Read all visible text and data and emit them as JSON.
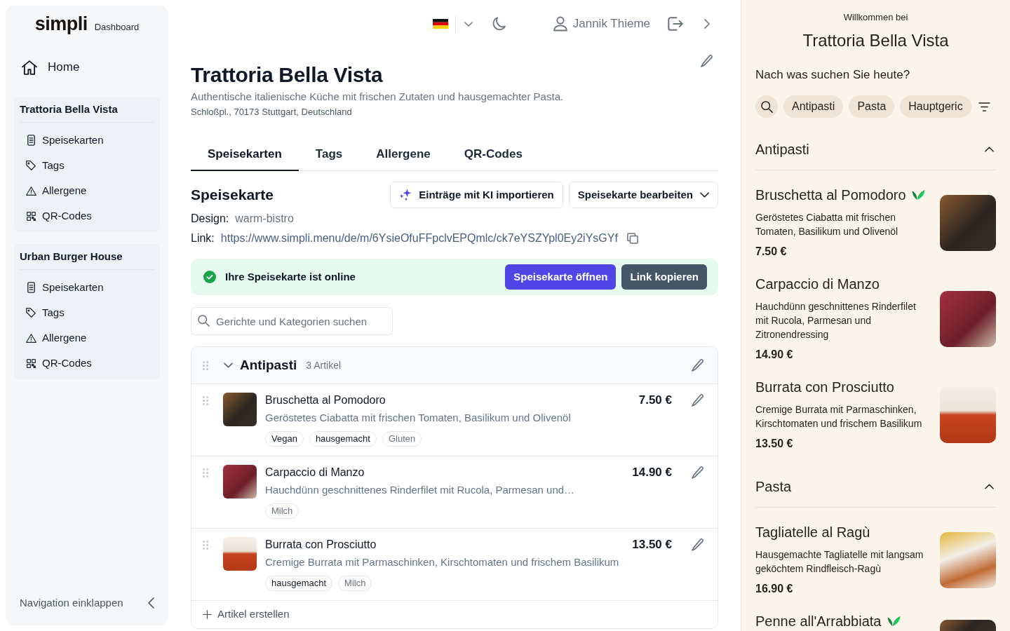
{
  "sidebar": {
    "logo": "simpli",
    "logo_caption": "Dashboard",
    "home": "Home",
    "restaurants": [
      {
        "name": "Trattoria Bella Vista",
        "items": [
          {
            "label": "Speisekarten",
            "kind": "menus"
          },
          {
            "label": "Tags",
            "kind": "tags"
          },
          {
            "label": "Allergene",
            "kind": "allergens"
          },
          {
            "label": "QR-Codes",
            "kind": "qr"
          }
        ]
      },
      {
        "name": "Urban Burger House",
        "items": [
          {
            "label": "Speisekarten",
            "kind": "menus"
          },
          {
            "label": "Tags",
            "kind": "tags"
          },
          {
            "label": "Allergene",
            "kind": "allergens"
          },
          {
            "label": "QR-Codes",
            "kind": "qr"
          }
        ]
      }
    ],
    "collapse": "Navigation einklappen"
  },
  "topbar": {
    "user": "Jannik Thieme"
  },
  "restaurant": {
    "name": "Trattoria Bella Vista",
    "description": "Authentische italienische Küche mit frischen Zutaten und hausgemachter Pasta.",
    "address": "Schloßpl., 70173 Stuttgart, Deutschland"
  },
  "tabs": [
    {
      "label": "Speisekarten",
      "selected": true
    },
    {
      "label": "Tags",
      "selected": false
    },
    {
      "label": "Allergene",
      "selected": false
    },
    {
      "label": "QR-Codes",
      "selected": false
    }
  ],
  "menu": {
    "heading": "Speisekarte",
    "actions": [
      {
        "label": "Einträge mit KI importieren",
        "kind": "ai"
      },
      {
        "label": "Speisekarte bearbeiten",
        "kind": "dropdown"
      }
    ],
    "design_label": "Design:",
    "design": "warm-bistro",
    "link_label": "Link:",
    "link": "https://www.simpli.menu/de/m/6YsieOfuFFpclvEPQmlc/ck7eYSZYpl0Ey2iYsGYf",
    "status": "Ihre Speisekarte ist online",
    "status_actions": [
      {
        "label": "Speisekarte öffnen",
        "kind": "primary"
      },
      {
        "label": "Link kopieren",
        "kind": "secondary"
      }
    ],
    "search": {
      "placeholder": "Gerichte und Kategorien suchen"
    }
  },
  "categories": [
    {
      "name": "Antipasti",
      "count": "3 Artikel",
      "expanded": true,
      "items": [
        {
          "name": "Bruschetta al Pomodoro",
          "description": "Geröstetes Ciabatta mit frischen Tomaten, Basilikum und Olivenöl",
          "price": "7.50 €",
          "tags": [
            {
              "label": "Vegan",
              "kind": "tag"
            },
            {
              "label": "hausgemacht",
              "kind": "tag"
            },
            {
              "label": "Gluten",
              "kind": "allergen"
            }
          ]
        },
        {
          "name": "Carpaccio di Manzo",
          "description": "Hauchdünn geschnittenes Rinderfilet mit Rucola, Parmesan und…",
          "price": "14.90 €",
          "tags": [
            {
              "label": "Milch",
              "kind": "allergen"
            }
          ]
        },
        {
          "name": "Burrata con Prosciutto",
          "description": "Cremige Burrata mit Parmaschinken, Kirschtomaten und frischem Basilikum",
          "price": "13.50 €",
          "tags": [
            {
              "label": "hausgemacht",
              "kind": "tag"
            },
            {
              "label": "Milch",
              "kind": "allergen"
            }
          ]
        }
      ],
      "add_label": "Artikel erstellen"
    }
  ],
  "preview": {
    "welcome": "Willkommen bei",
    "title": "Trattoria Bella Vista",
    "prompt": "Nach was suchen Sie heute?",
    "chips": [
      {
        "label": "Antipasti"
      },
      {
        "label": "Pasta"
      },
      {
        "label": "Hauptgeric"
      }
    ],
    "sections": [
      {
        "name": "Antipasti",
        "expanded": true,
        "items": [
          {
            "name": "Bruschetta al Pomodoro",
            "vegan": true,
            "description": "Geröstetes Ciabatta mit frischen Tomaten, Basilikum und Olivenöl",
            "price": "7.50 €"
          },
          {
            "name": "Carpaccio di Manzo",
            "vegan": false,
            "description": "Hauchdünn geschnittenes Rinderfilet mit Rucola, Parmesan und Zitronendressing",
            "price": "14.90 €"
          },
          {
            "name": "Burrata con Prosciutto",
            "vegan": false,
            "description": "Cremige Burrata mit Parmaschinken, Kirschtomaten und frischem Basilikum",
            "price": "13.50 €"
          }
        ]
      },
      {
        "name": "Pasta",
        "expanded": true,
        "items": [
          {
            "name": "Tagliatelle al Ragù",
            "vegan": false,
            "description": "Hausgemachte Tagliatelle mit langsam geköchtem Rindfleisch-Ragù",
            "price": "16.90 €"
          },
          {
            "name": "Penne all'Arrabbiata",
            "vegan": true
          }
        ]
      }
    ]
  }
}
